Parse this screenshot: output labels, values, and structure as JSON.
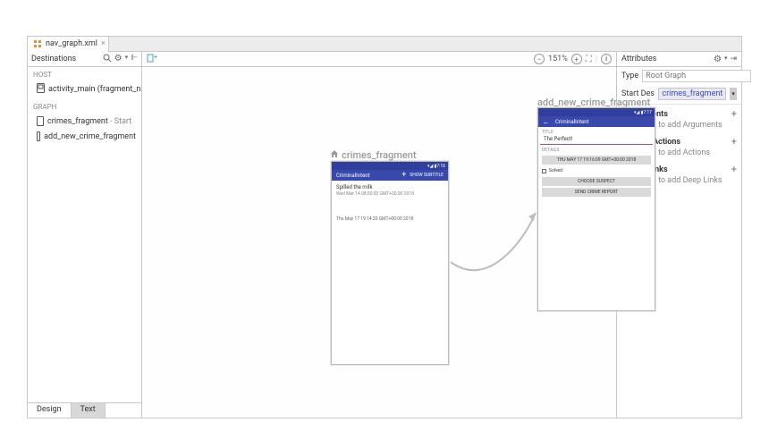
{
  "tab": {
    "filename": "nav_graph.xml"
  },
  "left": {
    "title": "Destinations",
    "hostLabel": "HOST",
    "hostRow": "activity_main (fragment_nav_hos",
    "graphLabel": "GRAPH",
    "items": [
      {
        "name": "crimes_fragment",
        "suffix": " - Start"
      },
      {
        "name": "add_new_crime_fragment",
        "suffix": ""
      }
    ]
  },
  "footer": {
    "design": "Design",
    "text": "Text"
  },
  "toolbar": {
    "zoom": "151%"
  },
  "canvas": {
    "dest1": {
      "label": "crimes_fragment",
      "appTitle": "CriminalIntent",
      "action": "SHOW SUBTITLE",
      "statusTime": "7:16",
      "rows": [
        {
          "title": "Spilled the milk",
          "sub": "Wed Mar 14 08:00:00 GMT+00:00 2018"
        },
        {
          "title": "Thu May 17 19:14:20 GMT+00:00 2018",
          "sub": ""
        }
      ]
    },
    "dest2": {
      "label": "add_new_crime_fragment",
      "appTitle": "CriminalIntent",
      "statusTime": "7:17",
      "lblTitle": "TITLE",
      "fieldTitle": "The Perfect!",
      "lblDetails": "DETAILS",
      "dateBtn": "THU MAY 17 19:16:09 GMT+00:00 2018",
      "solved": "Solved",
      "suspectBtn": "CHOOSE SUSPECT",
      "reportBtn": "SEND CRIME REPORT"
    }
  },
  "attrs": {
    "header": "Attributes",
    "typeLbl": "Type",
    "typePh": "Root Graph",
    "sdLbl": "Start Destinatic",
    "sdVal": "crimes_fragment",
    "sections": [
      {
        "title": "Arguments",
        "hint": "Click + to add Arguments"
      },
      {
        "title": "Global Actions",
        "hint": "Click + to add Actions"
      },
      {
        "title": "Deep Links",
        "hint": "Click + to add Deep Links"
      }
    ]
  }
}
